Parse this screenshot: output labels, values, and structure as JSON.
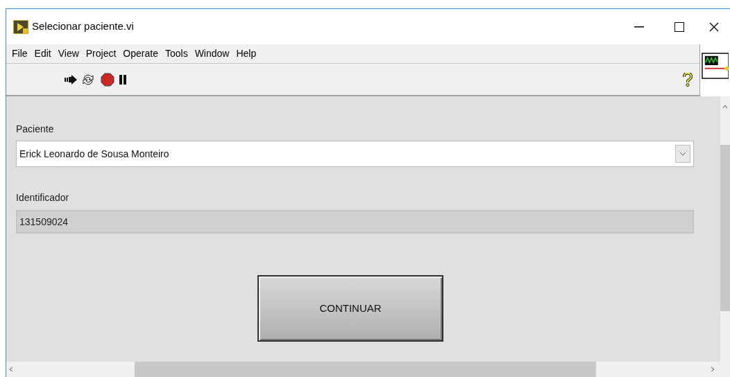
{
  "window": {
    "title": "Selecionar paciente.vi"
  },
  "menu": [
    "File",
    "Edit",
    "View",
    "Project",
    "Operate",
    "Tools",
    "Window",
    "Help"
  ],
  "patient": {
    "label": "Paciente",
    "value": "Erick Leonardo de Sousa Monteiro"
  },
  "identifier": {
    "label": "Identificador",
    "value": "131509024"
  },
  "button": {
    "label": "CONTINUAR"
  }
}
